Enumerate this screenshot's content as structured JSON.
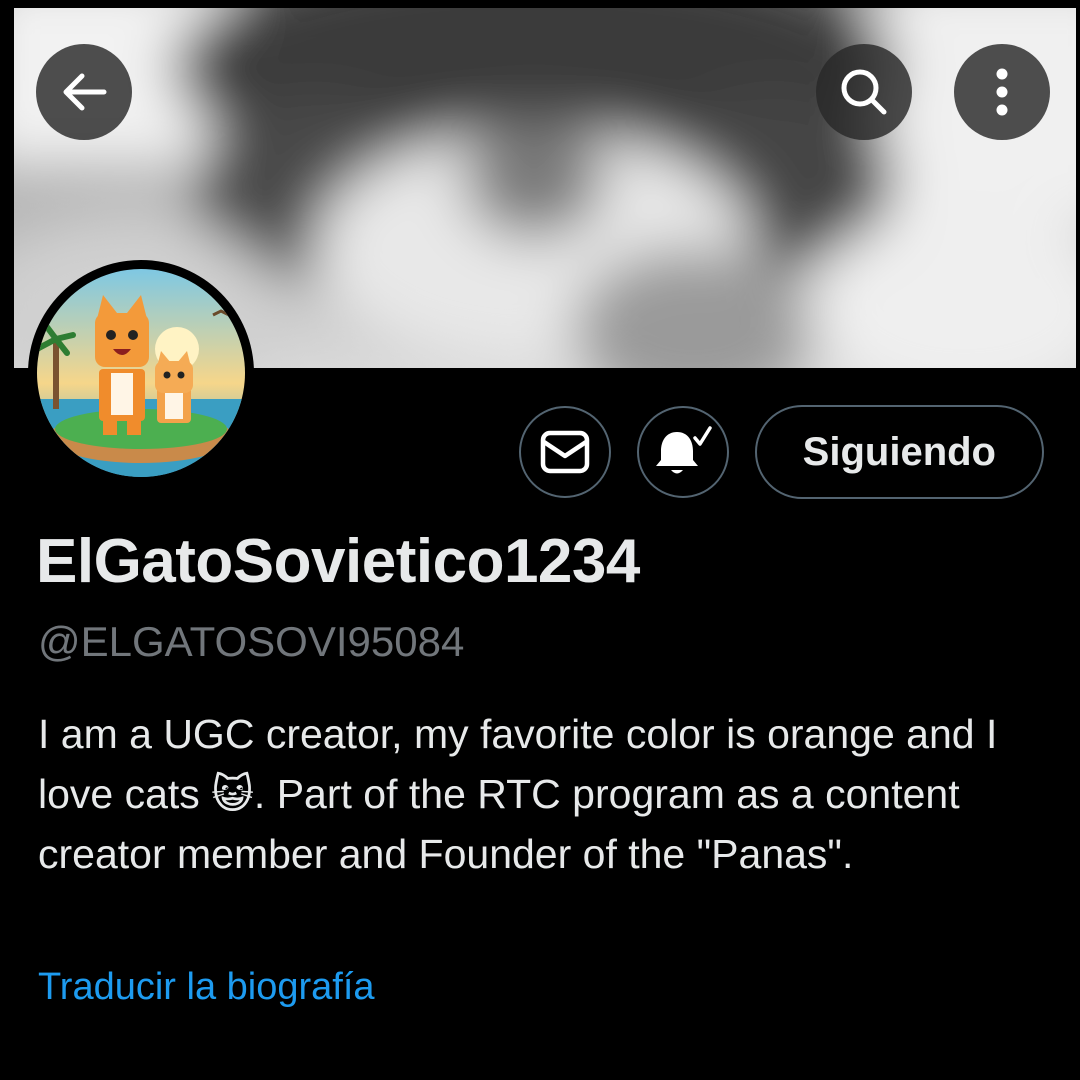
{
  "profile": {
    "display_name": "ElGatoSovietico1234",
    "handle": "@ELGATOSOVI95084",
    "bio": "I am a UGC creator, my favorite color is orange and I love cats 😺. Part of the RTC program as a content creator member and Founder of the \"Panas\".",
    "translate_bio_label": "Traducir la biografía"
  },
  "actions": {
    "follow_label": "Siguiendo"
  },
  "icons": {
    "back": "arrow-left-icon",
    "search": "search-icon",
    "more": "more-vertical-icon",
    "message": "envelope-icon",
    "notifications": "bell-check-icon"
  },
  "colors": {
    "background": "#000000",
    "text_primary": "#e7e9ea",
    "text_secondary": "#71767b",
    "link": "#1d9bf0",
    "button_border": "#536471"
  }
}
